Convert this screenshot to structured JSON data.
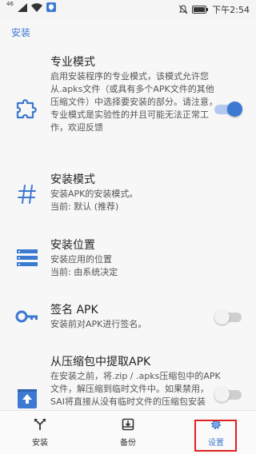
{
  "statusbar": {
    "carrier": "46",
    "time": "下午2:54"
  },
  "page": {
    "title": "安装"
  },
  "settings": [
    {
      "title": "专业模式",
      "desc": "启用安装程序的专业模式，该模式允许您从.apks文件（或具有多个APK文件的其他压缩文件）中选择要安装的部分。请注意，专业模式是实验性的并且可能无法正常工作，欢迎反馈",
      "enabled": true
    },
    {
      "title": "安装模式",
      "desc": "安装APK的安装模式。",
      "current": "当前: 默认 (推荐)"
    },
    {
      "title": "安装位置",
      "desc": "安装应用的位置",
      "current": "当前: 由系统决定"
    },
    {
      "title": "签名 APK",
      "desc": "安装前对APK进行签名。",
      "enabled": false
    },
    {
      "title": "从压缩包中提取APK",
      "desc": "在安装之前，将.zip / .apks压缩包中的APK文件，解压缩到临时文件中。如果禁用，SAI将直接从没有临时文件的压缩包安装APK。不",
      "enabled": false
    }
  ],
  "bottomnav": {
    "items": [
      {
        "label": "安装"
      },
      {
        "label": "备份"
      },
      {
        "label": "设置"
      }
    ],
    "active": "设置"
  },
  "colors": {
    "accent": "#3c79d1",
    "toggle_on_track": "#b3caf0",
    "toggle_off_track": "#cfcfcf",
    "highlight": "#e02020"
  }
}
